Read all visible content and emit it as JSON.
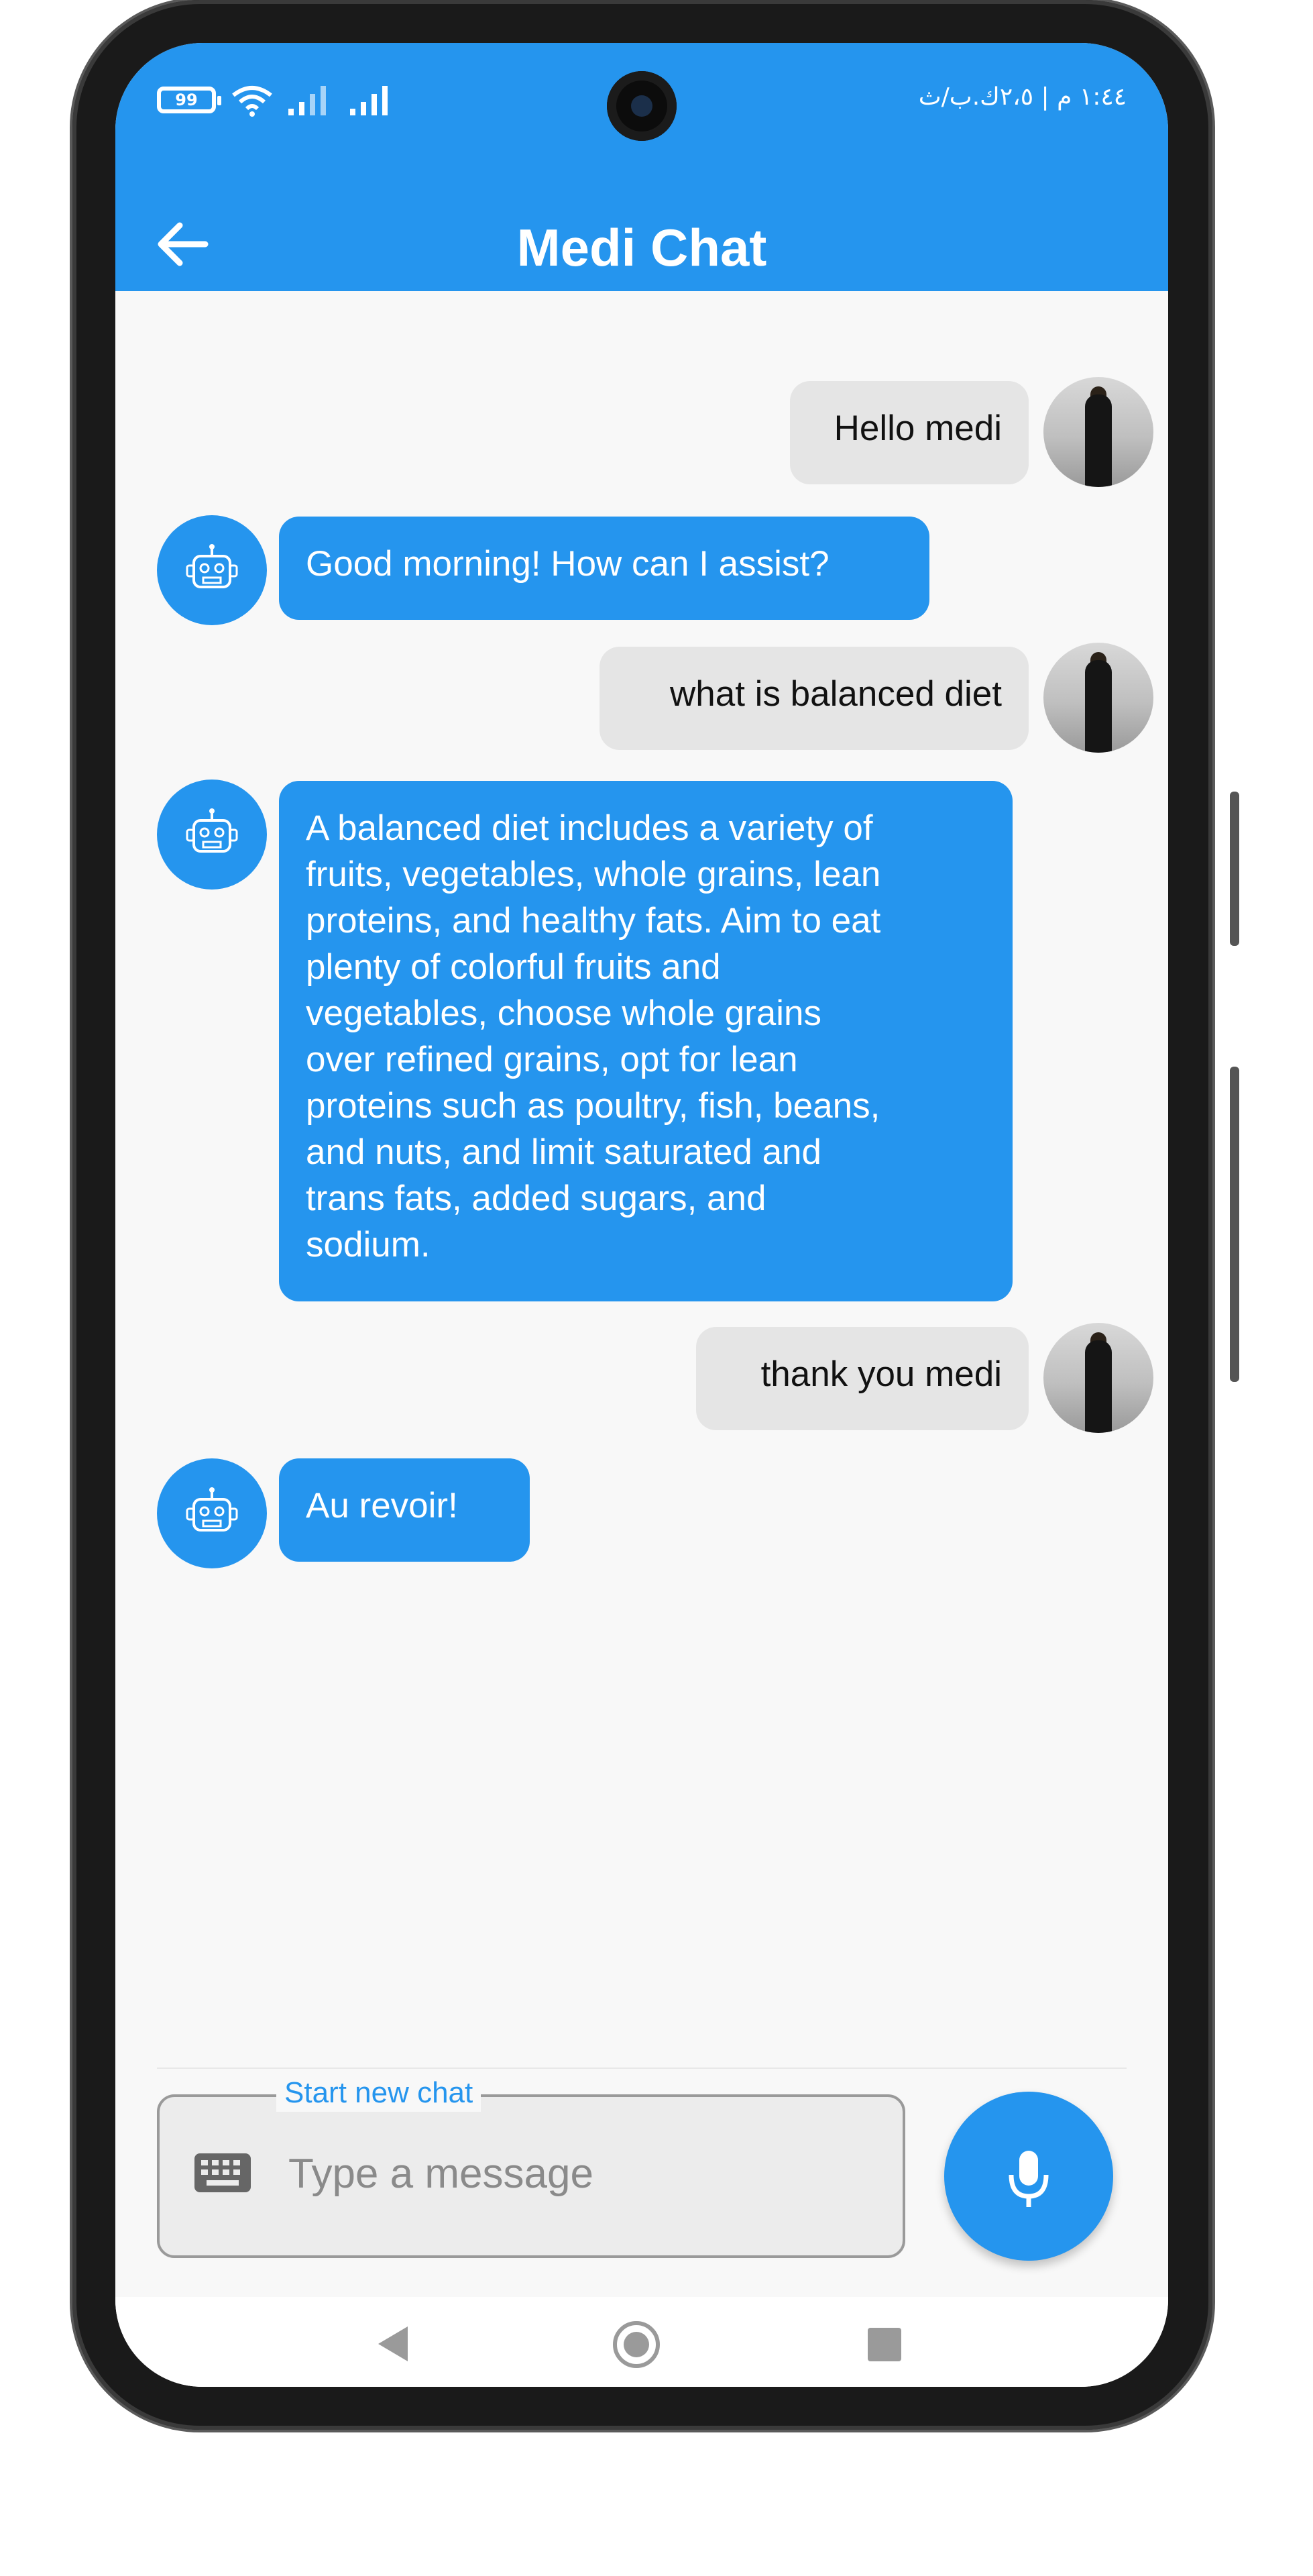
{
  "status_bar": {
    "battery": "99",
    "time": "١:٤٤ م | ٢،٥ك.ب/ث"
  },
  "header": {
    "title": "Medi Chat",
    "back_icon": "arrow-left-icon"
  },
  "messages": [
    {
      "sender": "user",
      "text": "Hello medi"
    },
    {
      "sender": "bot",
      "text": "Good morning! How can I assist?"
    },
    {
      "sender": "user",
      "text": "what is balanced diet"
    },
    {
      "sender": "bot",
      "lines": [
        "A balanced diet includes a variety of",
        "fruits, vegetables, whole grains, lean",
        "proteins, and healthy fats. Aim to eat",
        "plenty of colorful fruits and",
        "vegetables, choose whole grains",
        "over refined grains, opt for lean",
        "proteins such as poultry, fish, beans,",
        "and nuts, and limit saturated and",
        "trans fats, added sugars, and",
        "sodium."
      ]
    },
    {
      "sender": "user",
      "text": "thank you medi"
    },
    {
      "sender": "bot",
      "text": "Au revoir!"
    }
  ],
  "composer": {
    "legend": "Start new chat",
    "placeholder": "Type a message",
    "keyboard_icon": "keyboard-icon",
    "mic_icon": "microphone-icon"
  },
  "colors": {
    "primary": "#2595ee",
    "user_bubble": "#e5e5e5",
    "background": "#f8f8f8"
  }
}
